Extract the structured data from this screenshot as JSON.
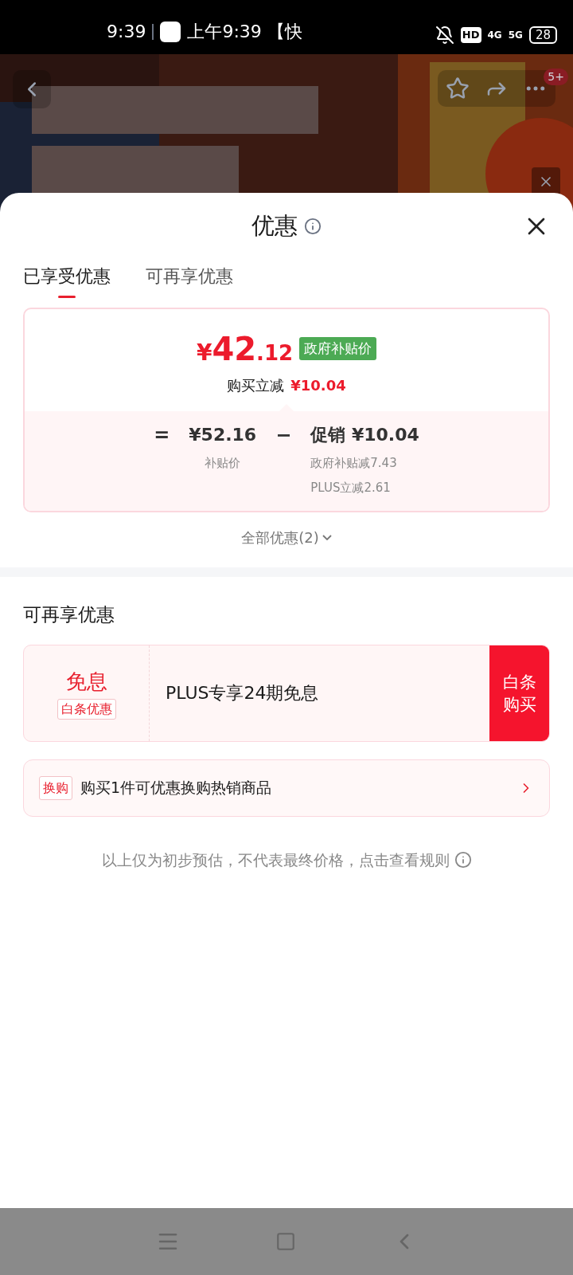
{
  "status_bar": {
    "time": "9:39",
    "ticker": "上午9:39 【快",
    "network": [
      "HD",
      "4G",
      "5G"
    ],
    "battery": "28"
  },
  "product_header": {
    "kind": "picture",
    "badge": "5+"
  },
  "sheet": {
    "title": "优惠",
    "tabs": [
      {
        "label": "已享受优惠",
        "selected": true
      },
      {
        "label": "可再享优惠",
        "selected": false
      }
    ],
    "summary": {
      "currency": "¥",
      "price_integer": "42",
      "price_decimal": ".12",
      "price_tag": "政府补贴价",
      "reduction_label": "购买立减",
      "reduction_value": "¥10.04",
      "formula": [
        {
          "kind": "operator",
          "text": "="
        },
        {
          "kind": "amount",
          "text": "¥52.16",
          "notes": [
            "补贴价"
          ]
        },
        {
          "kind": "operator",
          "text": "−"
        },
        {
          "kind": "amount",
          "text": "促销 ¥10.04",
          "notes": [
            "政府补贴减7.43",
            "PLUS立减2.61"
          ]
        }
      ]
    },
    "all_offers": "全部优惠(2)",
    "more_section": {
      "heading": "可再享优惠",
      "coupon": {
        "title": "免息",
        "tag": "白条优惠",
        "description": "PLUS专享24期免息",
        "action": [
          "白条",
          "购买"
        ]
      },
      "exchange": {
        "tag": "换购",
        "text": "购买1件可优惠换购热销商品"
      }
    },
    "disclaimer": "以上仅为初步预估，不代表最终价格，点击查看规则"
  }
}
